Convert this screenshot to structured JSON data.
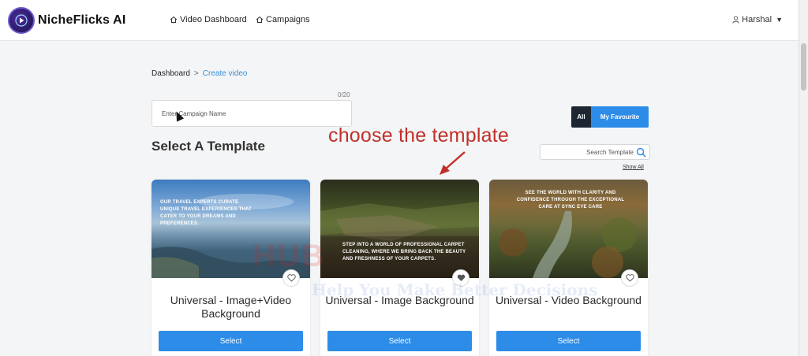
{
  "header": {
    "brand": "NicheFlicks AI",
    "nav": [
      {
        "label": "Video Dashboard"
      },
      {
        "label": "Campaigns"
      }
    ],
    "user": "Harshal"
  },
  "breadcrumb": {
    "root": "Dashboard",
    "separator": ">",
    "current": "Create video"
  },
  "campaign": {
    "counter": "0/20",
    "placeholder": "Enter Campaign Name"
  },
  "section_title": "Select A Template",
  "filters": {
    "all_label": "All",
    "favourite_label": "My Favourite"
  },
  "search": {
    "placeholder": "Search Template",
    "show_all": "Show All"
  },
  "annotation": "choose the template",
  "watermark": {
    "line1": "HUB",
    "line2": "Help You Make Better Decisions"
  },
  "templates": [
    {
      "name": "Universal - Image+Video Background",
      "thumb_text": "Our travel experts curate unique travel experiences that cater to your dreams and preferences.",
      "button": "Select"
    },
    {
      "name": "Universal - Image Background",
      "thumb_text": "Step into a world of professional carpet cleaning, where we bring back the beauty and freshness of your carpets.",
      "button": "Select"
    },
    {
      "name": "Universal - Video Background",
      "thumb_text": "See the world with clarity and confidence through the exceptional care at Sync Eye Care",
      "button": "Select"
    }
  ],
  "colors": {
    "accent": "#2c8ce8",
    "dark_button": "#1d2733",
    "annotation": "#c0302a",
    "link": "#3b8ed8"
  }
}
